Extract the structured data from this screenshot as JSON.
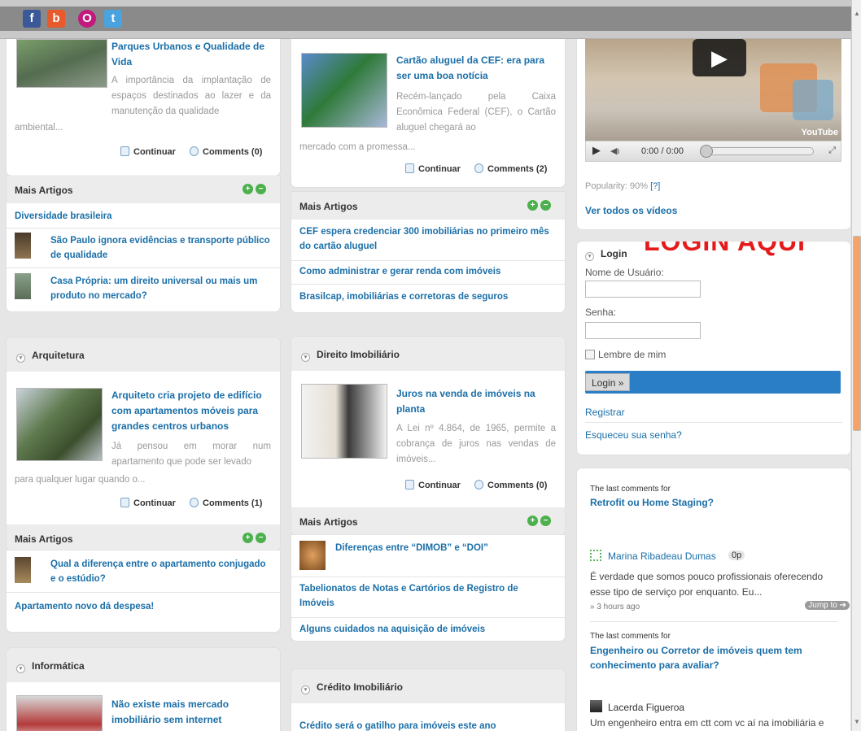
{
  "topbar": {
    "social": [
      {
        "name": "facebook-icon",
        "glyph": "f",
        "color": "#3b5998"
      },
      {
        "name": "flickr-icon",
        "glyph": "b",
        "color": "#e85a2c"
      },
      {
        "name": "orkut-icon",
        "glyph": "O",
        "color": "#c2197d"
      },
      {
        "name": "twitter-icon",
        "glyph": "t",
        "color": "#4aa3df"
      }
    ]
  },
  "col1": {
    "card1": {
      "title": "Parques Urbanos e Qualidade de Vida",
      "excerpt": "A importância da implantação de espaços destinados ao lazer e da manutenção da qualidade",
      "excerpt_tail": "ambiental...",
      "continuar": "Continuar",
      "comments": "Comments (0)"
    },
    "mais1": {
      "label": "Mais Artigos",
      "items": [
        "Diversidade brasileira",
        "São Paulo ignora evidências e transporte público de qualidade",
        "Casa Própria: um direito universal ou mais um produto no mercado?"
      ]
    },
    "arquitetura": {
      "heading": "Arquitetura",
      "title": "Arquiteto cria projeto de edifício com apartamentos móveis para grandes centros urbanos",
      "excerpt": "Já pensou em morar num apartamento que pode ser levado",
      "excerpt_tail": "para qualquer lugar quando o...",
      "continuar": "Continuar",
      "comments": "Comments (1)"
    },
    "mais2": {
      "label": "Mais Artigos",
      "items": [
        "Qual a diferença entre o apartamento conjugado e o estúdio?",
        "Apartamento novo dá despesa!"
      ]
    },
    "informatica": {
      "heading": "Informática",
      "title": "Não existe mais mercado imobiliário sem internet"
    }
  },
  "col2": {
    "card1": {
      "title": "Cartão aluguel da CEF: era para ser uma boa notícia",
      "excerpt": "Recém-lançado pela Caixa Econômica Federal (CEF), o Cartão aluguel chegará ao",
      "excerpt_tail": "mercado com a promessa...",
      "continuar": "Continuar",
      "comments": "Comments (2)"
    },
    "mais1": {
      "label": "Mais Artigos",
      "items": [
        "CEF espera credenciar 300 imobiliárias no primeiro mês do cartão aluguel",
        "Como administrar e gerar renda com imóveis",
        "Brasilcap, imobiliárias e corretoras de seguros"
      ]
    },
    "direito": {
      "heading": "Direito Imobiliário",
      "title": "Juros na venda de imóveis na planta",
      "excerpt": "A Lei nº 4.864, de 1965, permite a cobrança de juros nas vendas de imóveis...",
      "continuar": "Continuar",
      "comments": "Comments (0)"
    },
    "mais2": {
      "label": "Mais Artigos",
      "items": [
        "Diferenças entre “DIMOB” e “DOI”",
        "Tabelionatos de Notas e Cartórios de Registro de Imóveis",
        "Alguns cuidados na aquisição de imóveis"
      ]
    },
    "credito": {
      "heading": "Crédito Imobiliário",
      "title": "Crédito será o gatilho para imóveis este ano"
    }
  },
  "col3": {
    "video": {
      "time": "0:00 / 0:00",
      "youtube": "YouTube",
      "popularity": "Popularity: 90%",
      "popularity_link": "[?]",
      "all_videos": "Ver todos os vídeos"
    },
    "login": {
      "heading": "Login",
      "banner": "LOGIN AQUI",
      "user_label": "Nome de Usuário:",
      "pass_label": "Senha:",
      "remember": "Lembre de mim",
      "button": "Login »",
      "register": "Registrar",
      "forgot": "Esqueceu sua senha?"
    },
    "comments": {
      "c1": {
        "prefix": "The last comments for",
        "post": "Retrofit ou Home Staging?",
        "author": "Marina Ribadeau Dumas",
        "score": "0p",
        "text": "É verdade que somos pouco profissionais oferecendo esse tipo de serviço por enquanto. Eu...",
        "time": "» 3 hours ago",
        "jump": "Jump to ➔"
      },
      "c2": {
        "prefix": "The last comments for",
        "post": "Engenheiro ou Corretor de imóveis quem tem conhecimento para avaliar?",
        "author": "Lacerda Figueroa",
        "text": "Um engenheiro entra em ctt com vc aí na imobiliária e"
      }
    }
  }
}
